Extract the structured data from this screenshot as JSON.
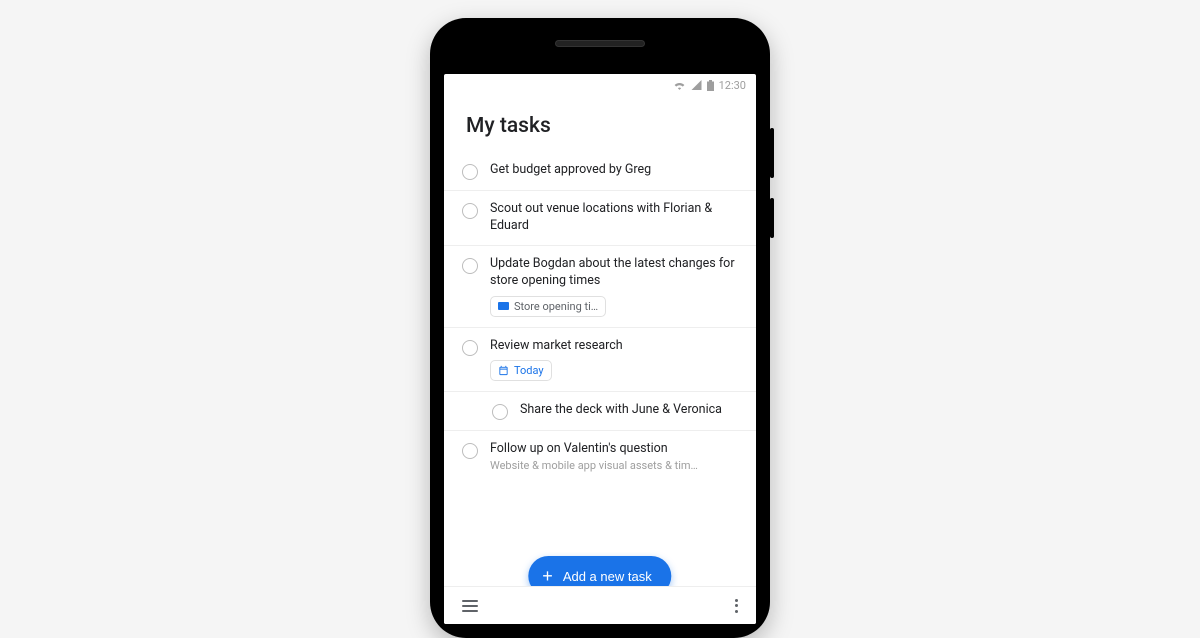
{
  "status_bar": {
    "time": "12:30"
  },
  "page": {
    "title": "My tasks"
  },
  "tasks": [
    {
      "title": "Get budget approved by Greg",
      "subtitle": "",
      "chip": null,
      "subtask": false
    },
    {
      "title": "Scout out venue locations with Florian & Eduard",
      "subtitle": "",
      "chip": null,
      "subtask": false
    },
    {
      "title": "Update Bogdan about the latest changes for store opening times",
      "subtitle": "",
      "chip": {
        "type": "email",
        "label": "Store opening ti…"
      },
      "subtask": false
    },
    {
      "title": "Review market research",
      "subtitle": "",
      "chip": {
        "type": "date",
        "label": "Today"
      },
      "subtask": false
    },
    {
      "title": "Share the deck with June & Veronica",
      "subtitle": "",
      "chip": null,
      "subtask": true
    },
    {
      "title": "Follow up on Valentin's question",
      "subtitle": "Website & mobile app visual assets & tim…",
      "chip": null,
      "subtask": false
    }
  ],
  "fab": {
    "label": "Add a new task"
  }
}
